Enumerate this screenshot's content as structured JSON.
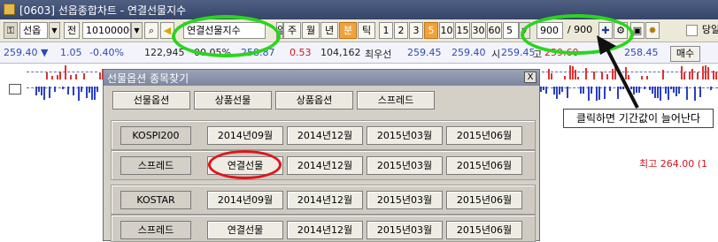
{
  "window": {
    "title": "[0603] 선옵종합차트 - 연결선물지수"
  },
  "toolbar": {
    "product_select": "선옵",
    "prev_label": "전",
    "code_input": "10100000",
    "name_input": "연결선물지수",
    "period_buttons": [
      "일",
      "주",
      "월",
      "년",
      "분",
      "틱"
    ],
    "active_period": "분",
    "minute_buttons": [
      "1",
      "2",
      "3",
      "5",
      "10",
      "15",
      "30",
      "60"
    ],
    "active_minute": "5",
    "tick_select": "5",
    "count_input": "900",
    "count_total": "/ 900",
    "checkbox_label": "당일"
  },
  "ticker": {
    "price": "259.40",
    "change": "1.05",
    "change_pct": "-0.40%",
    "volume": "122,945",
    "vol_ratio": "00.05%",
    "field5": "258.87",
    "field6": "0.53",
    "open_interest": "104,162",
    "nearest_label": "최우선",
    "best1": "259.45",
    "best2": "259.40",
    "si_label": "시",
    "si_value": "259.45",
    "go_label": "고",
    "go_value": "259.60",
    "low_value": "258.45",
    "buy_label": "매수"
  },
  "dialog": {
    "title": "선물옵션 종목찾기",
    "tabs": [
      "선물옵션",
      "상품선물",
      "상품옵션",
      "스프레드"
    ],
    "rows": [
      {
        "label": "KOSPI200",
        "items": [
          "2014년09월",
          "2014년12월",
          "2015년03월",
          "2015년06월"
        ]
      },
      {
        "label": "스프레드",
        "items": [
          "연결선물",
          "2014년12월",
          "2015년03월",
          "2015년06월"
        ]
      },
      {
        "label": "KOSTAR",
        "items": [
          "2014년09월",
          "2014년12월",
          "2015년03월",
          "2015년06월"
        ]
      },
      {
        "label": "스프레드",
        "items": [
          "연결선물",
          "2014년12월",
          "2015년03월",
          "2015년06월"
        ]
      }
    ],
    "close_label": "X"
  },
  "annotations": {
    "callout_text": "클릭하면 기간값이 늘어난다",
    "highlight_color": "#2ad51e",
    "circle_color": "#e0151a"
  },
  "chart": {
    "high_label": "최고 264.00 (1"
  }
}
